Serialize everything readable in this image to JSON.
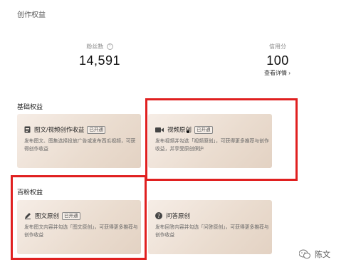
{
  "page_title": "创作权益",
  "stats": {
    "fans_label": "粉丝数",
    "fans_value": "14,591",
    "credit_label": "信用分",
    "credit_value": "100",
    "details_link": "查看详情 ›"
  },
  "sections": {
    "basic_title": "基础权益",
    "fans_title": "百粉权益"
  },
  "cards": {
    "article_video": {
      "title": "图文/视频创作收益",
      "badge": "已开通",
      "desc": "发布图文、图集选择投放广告或发布西瓜视频，可获得创作收益"
    },
    "video_original": {
      "title": "视频原创",
      "badge": "已开通",
      "desc": "发布视频并勾选「视频原创」，可获得更多推荐与创作收益，并享受原创保护"
    },
    "article_original": {
      "title": "图文原创",
      "badge": "已开通",
      "desc": "发布图文内容并勾选「图文原创」，可获得更多推荐与创作收益"
    },
    "qa_original": {
      "title": "问答原创",
      "desc": "发布回答内容并勾选「问答原创」，可获得更多推荐与创作收益"
    }
  },
  "watermark": "陈文",
  "colors": {
    "highlight_red": "#e02020",
    "card_bg": "#efe2d7"
  }
}
